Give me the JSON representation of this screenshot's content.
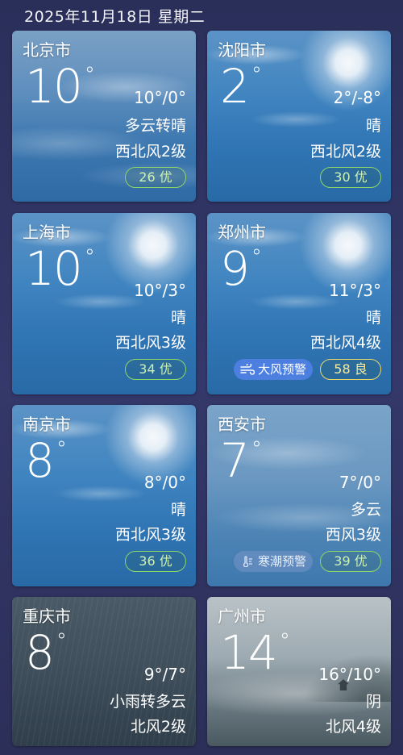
{
  "header": {
    "date": "2025年11月18日 星期二"
  },
  "cards": [
    {
      "city": "北京市",
      "temp": "10",
      "deg": "°",
      "range": "10°/0°",
      "cond": "多云转晴",
      "wind": "西北风2级",
      "aqi": "26 优"
    },
    {
      "city": "沈阳市",
      "temp": "2",
      "deg": "°",
      "range": "2°/-8°",
      "cond": "晴",
      "wind": "西北风2级",
      "aqi": "30 优"
    },
    {
      "city": "上海市",
      "temp": "10",
      "deg": "°",
      "range": "10°/3°",
      "cond": "晴",
      "wind": "西北风3级",
      "aqi": "34 优"
    },
    {
      "city": "郑州市",
      "temp": "9",
      "deg": "°",
      "range": "11°/3°",
      "cond": "晴",
      "wind": "西北风4级",
      "aqi": "58 良",
      "alert": "大风预警"
    },
    {
      "city": "南京市",
      "temp": "8",
      "deg": "°",
      "range": "8°/0°",
      "cond": "晴",
      "wind": "西北风3级",
      "aqi": "36 优"
    },
    {
      "city": "西安市",
      "temp": "7",
      "deg": "°",
      "range": "7°/0°",
      "cond": "多云",
      "wind": "西风3级",
      "aqi": "39 优",
      "alert": "寒潮预警"
    },
    {
      "city": "重庆市",
      "temp": "8",
      "deg": "°",
      "range": "9°/7°",
      "cond": "小雨转多云",
      "wind": "北风2级"
    },
    {
      "city": "广州市",
      "temp": "14",
      "deg": "°",
      "range": "16°/10°",
      "cond": "阴",
      "wind": "北风4级"
    }
  ],
  "colors": {
    "aqi_good": "#8cd66a",
    "aqi_moderate": "#e8d86a",
    "wind_alert": "#4c7fe0"
  },
  "icons": {
    "wind_alert": "wind-icon",
    "cold_alert": "thermometer-icon"
  }
}
